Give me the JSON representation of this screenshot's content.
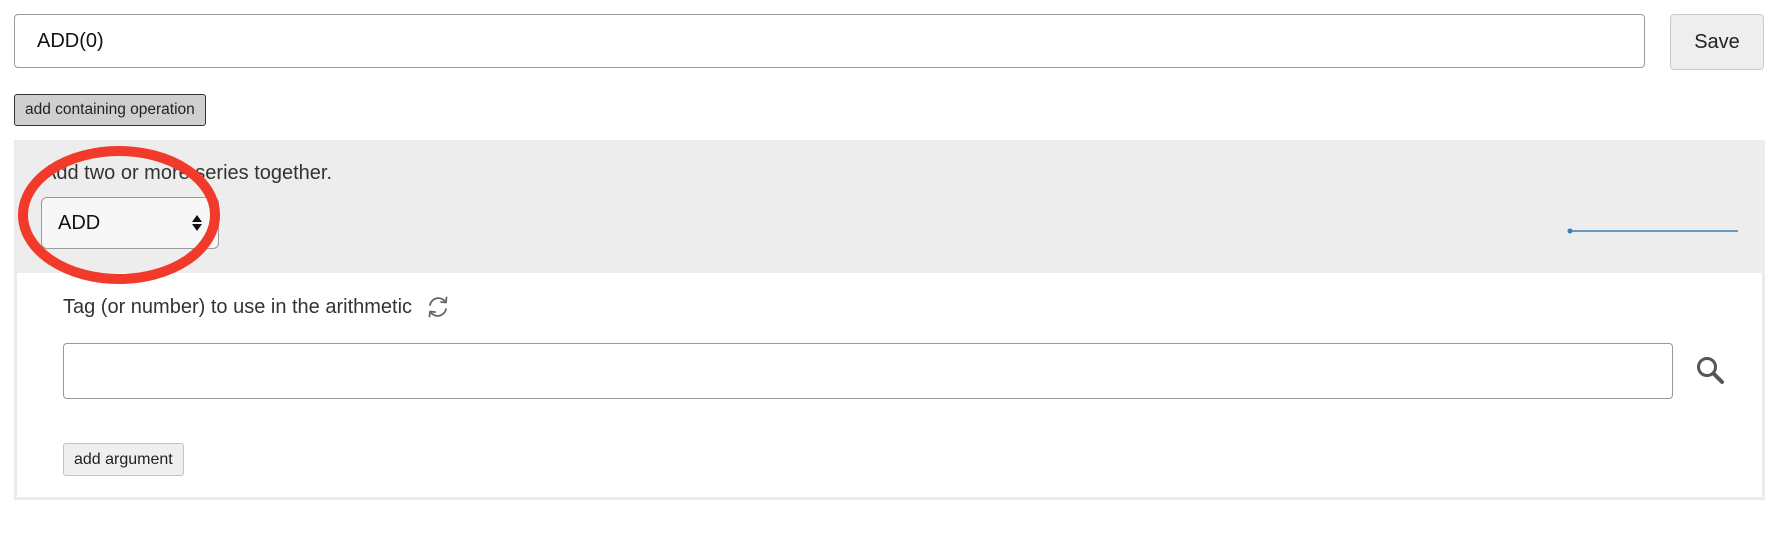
{
  "expression": {
    "value": "ADD(0)",
    "save_label": "Save"
  },
  "containing_operation_label": "add containing operation",
  "operation": {
    "description": "Add two or more series together.",
    "selected": "ADD",
    "sparkline_color": "#3a7fb8",
    "highlight_color": "#f23a2a"
  },
  "argument": {
    "label": "Tag (or number) to use in the arithmetic",
    "value": "",
    "placeholder": "",
    "add_label": "add argument"
  },
  "icons": {
    "refresh": "refresh-icon",
    "search": "search-icon",
    "select_arrows": "updown-arrows-icon"
  }
}
